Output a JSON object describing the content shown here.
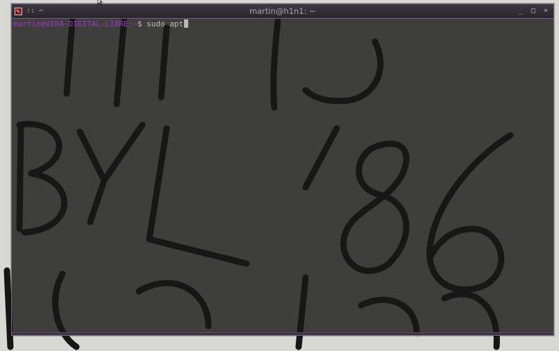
{
  "window": {
    "title": "martin@h1n1: ~",
    "menu_glyph": "::",
    "sticky_glyph": "−",
    "minimize_glyph": "_",
    "maximize_glyph": "□",
    "close_glyph": "×"
  },
  "terminal": {
    "user_host": "martin@VIDA-DIGITAL-LIBRE",
    "path": ":~",
    "prompt_symbol": "$",
    "command": " sudo apt"
  },
  "icons": {
    "app": "terminal-icon",
    "pointer": "mouse-pointer-icon"
  },
  "colors": {
    "prompt": "#9b3cc2",
    "terminal_bg": "#181818",
    "title_text": "#a9a5ab",
    "app_icon": "#7e1a18"
  }
}
